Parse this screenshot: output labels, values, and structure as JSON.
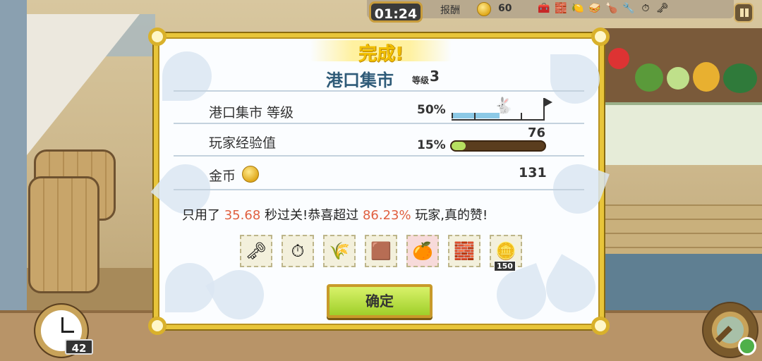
{
  "hud": {
    "timer": "01:24",
    "reward_label": "报酬",
    "reward_value": "60",
    "hud_items": [
      "🧰",
      "🧱",
      "🍋",
      "🥪",
      "🍗",
      "🔧",
      "⏱",
      "🗝"
    ]
  },
  "dialog": {
    "complete_title": "完成!",
    "location_name": "港口集市",
    "level_label": "等级",
    "level_value": "3",
    "rows": {
      "market_level": {
        "label": "港口集市 等级",
        "percent": "50%",
        "fraction": 0.5
      },
      "player_xp": {
        "label": "玩家经验值",
        "percent": "15%",
        "value": "76",
        "fraction": 0.15
      },
      "gold": {
        "label": "金币",
        "value": "131"
      }
    },
    "message": {
      "part1": "只用了 ",
      "time": "35.68",
      "part2": " 秒过关!恭喜超过 ",
      "percent": "86.23%",
      "part3": " 玩家,真的赞!"
    },
    "reward_items": [
      {
        "name": "key",
        "glyph": "🗝"
      },
      {
        "name": "pocket-watch",
        "glyph": "⏱"
      },
      {
        "name": "wheat-bundle",
        "glyph": "🌾"
      },
      {
        "name": "leather-hide",
        "glyph": "🟫"
      },
      {
        "name": "fruit-basket",
        "glyph": "🍊"
      },
      {
        "name": "brick",
        "glyph": "🧱"
      },
      {
        "name": "gold-coins",
        "glyph": "🪙",
        "count": "150"
      }
    ],
    "confirm_label": "确定"
  },
  "bottom": {
    "clock_count": "42"
  },
  "colors": {
    "dialog_border": "#e8c53a",
    "title_gold": "#f2c000",
    "location_blue": "#2f5b78",
    "highlight_red": "#e06040",
    "confirm_green": "#b6e060"
  }
}
